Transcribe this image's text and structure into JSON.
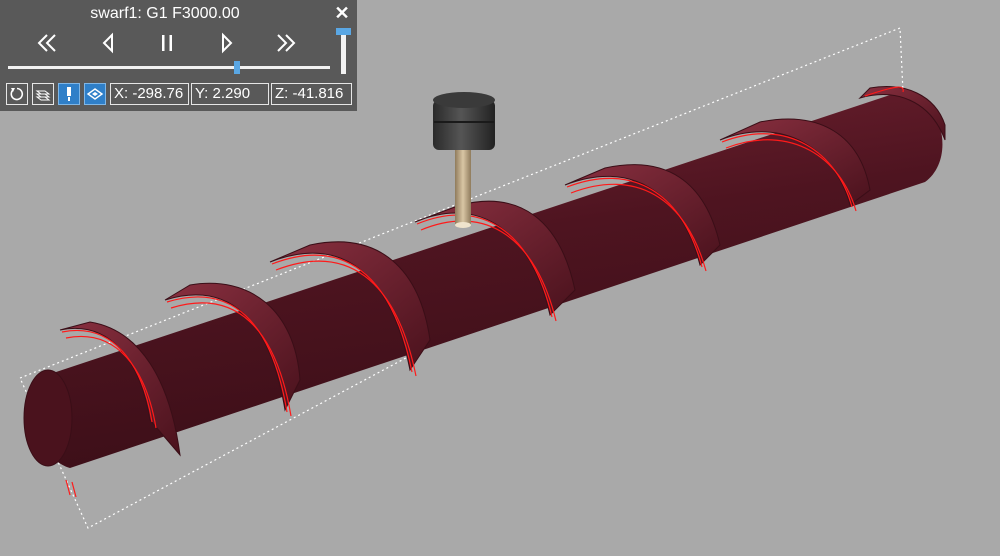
{
  "panel": {
    "title": "swarf1: G1 F3000.00",
    "close_label": "✕",
    "progress": 0.71,
    "speed": 1.0
  },
  "coords": {
    "x": "X: -298.76",
    "y": "Y: 2.290",
    "z": "Z: -41.816"
  },
  "icons": {
    "rewind": "rewind-icon",
    "step_back": "step-back-icon",
    "pause": "pause-icon",
    "step_forward": "step-forward-icon",
    "fast_forward": "fast-forward-icon",
    "reset": "reset-icon",
    "layers": "layers-icon",
    "tool": "tool-icon",
    "stock": "stock-icon"
  },
  "colors": {
    "panel_bg": "#595959",
    "accent": "#5aa7e4",
    "active_button": "#2f7fc8",
    "part": "#5c1a26",
    "toolpath": "#ff1a1a",
    "background": "#a9a9a9"
  }
}
